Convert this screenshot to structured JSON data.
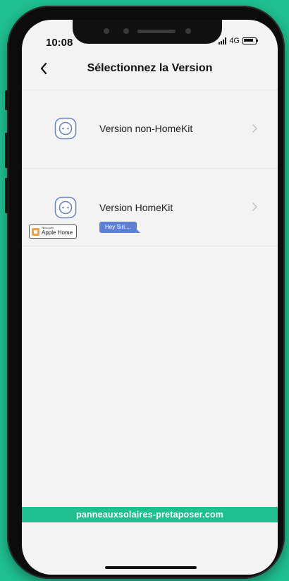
{
  "status_bar": {
    "time": "10:08",
    "network": "4G"
  },
  "header": {
    "title": "Sélectionnez la Version",
    "back_icon": "chevron-left-icon"
  },
  "versions": [
    {
      "label": "Version non-HomeKit",
      "icon": "smart-plug-icon"
    },
    {
      "label": "Version HomeKit",
      "icon": "smart-plug-icon",
      "siri_bubble": "Hey Siri....",
      "badge_small": "Works with",
      "badge_main": "Apple Home"
    }
  ],
  "banner": {
    "text": "panneauxsolaires-pretaposer.com"
  },
  "colors": {
    "background": "#1fbf8f",
    "screen": "#f3f3f3",
    "icon_accent": "#6a87c7",
    "siri_bubble": "#5d7fd6",
    "badge_home": "#f2a33c"
  }
}
